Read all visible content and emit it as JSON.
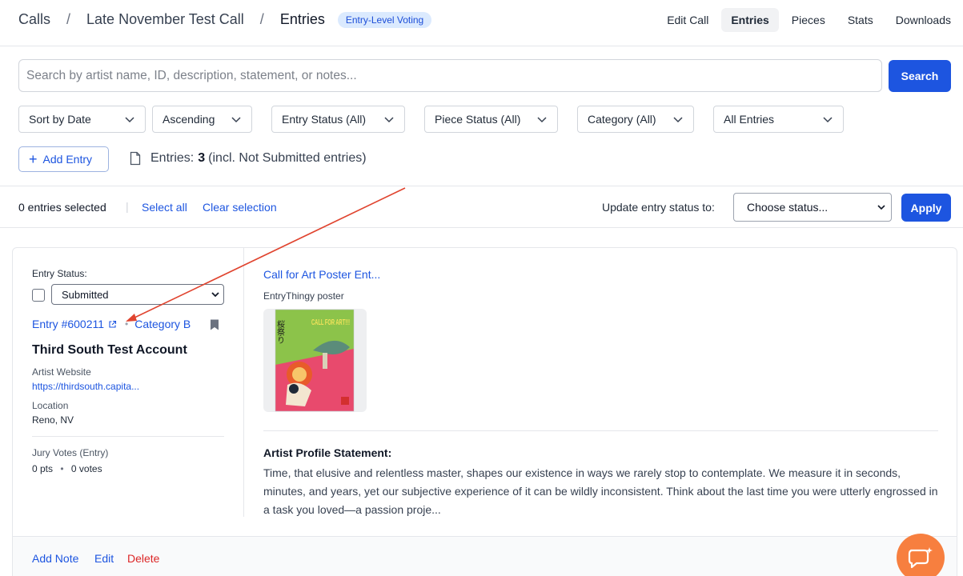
{
  "breadcrumb": {
    "items": [
      "Calls",
      "Late November Test Call",
      "Entries"
    ],
    "separator": "/",
    "badge": "Entry-Level Voting"
  },
  "nav": {
    "items": [
      "Edit Call",
      "Entries",
      "Pieces",
      "Stats",
      "Downloads"
    ],
    "active": "Entries"
  },
  "search": {
    "placeholder": "Search by artist name, ID, description, statement, or notes...",
    "value": "",
    "button_label": "Search"
  },
  "filters": {
    "sort_by": "Sort by Date",
    "order": "Ascending",
    "entry_status": "Entry Status (All)",
    "piece_status": "Piece Status (All)",
    "category": "Category (All)",
    "entries_scope": "All Entries"
  },
  "toolbar": {
    "add_entry_label": "Add Entry",
    "entries_label": "Entries:",
    "entries_count": "3",
    "entries_note": "(incl. Not Submitted entries)"
  },
  "selection": {
    "count_text": "0 entries selected",
    "pipe": "|",
    "select_all": "Select all",
    "clear_selection": "Clear selection",
    "update_label": "Update entry status to:",
    "status_placeholder": "Choose status...",
    "apply_label": "Apply"
  },
  "entry": {
    "status_label": "Entry Status:",
    "status_value": "Submitted",
    "entry_id": "Entry #600211",
    "category": "Category B",
    "artist_name": "Third South Test Account",
    "website_label": "Artist Website",
    "website_value": "https://thirdsouth.capita...",
    "location_label": "Location",
    "location_value": "Reno, NV",
    "votes_label": "Jury Votes (Entry)",
    "votes_pts": "0 pts",
    "votes_count": "0 votes",
    "piece_title": "Call for Art Poster Ent...",
    "piece_subtitle": "EntryThingy poster",
    "poster_text_top": "CALL FOR ART!!!",
    "poster_text_side": "桜祭り",
    "statement_title": "Artist Profile Statement:",
    "statement_text": "Time, that elusive and relentless master, shapes our existence in ways we rarely stop to contemplate. We measure it in seconds, minutes, and years, yet our subjective experience of it can be wildly inconsistent. Think about the last time you were utterly engrossed in a task you loved—a passion proje..."
  },
  "footer_actions": {
    "add_note": "Add Note",
    "edit": "Edit",
    "delete": "Delete"
  },
  "colors": {
    "primary": "#1d55e0",
    "danger": "#dc2626",
    "chat": "#f77f3f",
    "annotation_arrow": "#e0442f"
  }
}
